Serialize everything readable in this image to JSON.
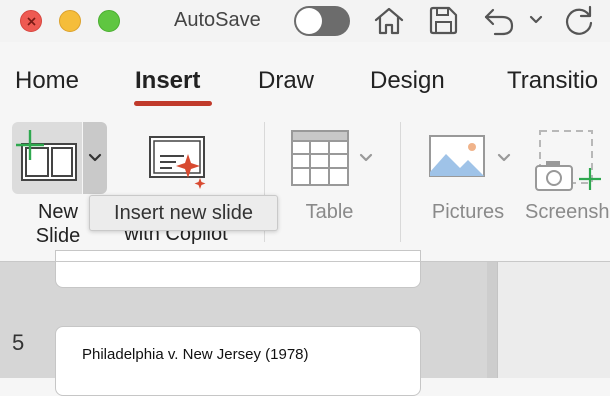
{
  "window": {
    "autosave_label": "AutoSave",
    "autosave_on": false
  },
  "tabs": [
    {
      "label": "Home",
      "active": false
    },
    {
      "label": "Insert",
      "active": true
    },
    {
      "label": "Draw",
      "active": false
    },
    {
      "label": "Design",
      "active": false
    },
    {
      "label": "Transitio",
      "active": false
    }
  ],
  "ribbon": {
    "new_slide": {
      "line1": "New",
      "line2": "Slide",
      "icon": "new-slide-icon"
    },
    "copilot": {
      "line2": "with Copilot",
      "icon": "copilot-slide-icon"
    },
    "table": {
      "label": "Table",
      "icon": "table-icon"
    },
    "pictures": {
      "label": "Pictures",
      "icon": "pictures-icon"
    },
    "screenshot": {
      "label": "Screensh",
      "icon": "screenshot-icon"
    }
  },
  "tooltip": {
    "text": "Insert new slide"
  },
  "slides": {
    "current_number": "5",
    "current_title": "Philadelphia v. New Jersey (1978)"
  },
  "colors": {
    "accent": "#c03a2b",
    "close": "#ee5a52",
    "minimize": "#f5bd3a",
    "maximize": "#5fc641",
    "new_slide_plus": "#2fa84f"
  }
}
